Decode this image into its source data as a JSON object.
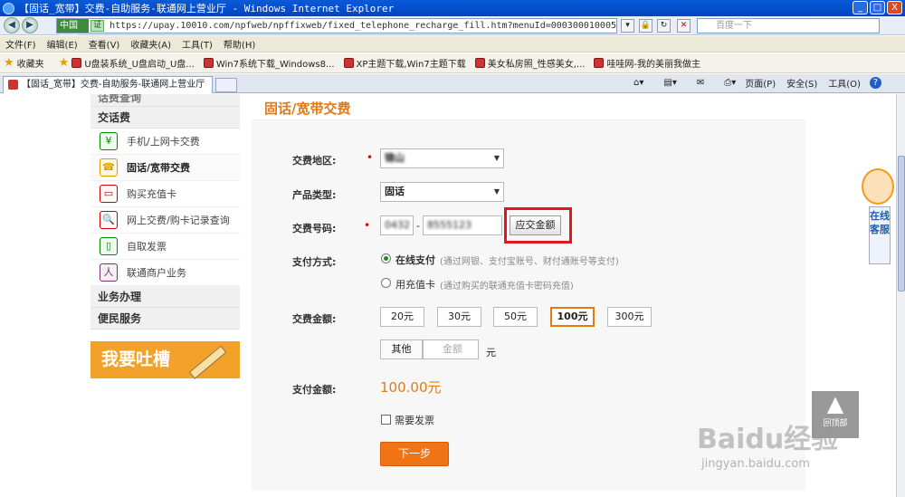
{
  "window": {
    "title": "【固话_宽带】交费-自助服务-联通网上营业厅 - Windows Internet Explorer",
    "min": "_",
    "max": "□",
    "close": "X"
  },
  "address": {
    "tag": "中国联通官网",
    "cert": "证",
    "url": "https://upay.10010.com/npfweb/npffixweb/fixed_telephone_recharge_fill.htm?menuId=000300010005",
    "search_placeholder": "百度一下"
  },
  "menu": [
    "文件(F)",
    "编辑(E)",
    "查看(V)",
    "收藏夹(A)",
    "工具(T)",
    "帮助(H)"
  ],
  "favorites": {
    "label": "收藏夹",
    "items": [
      "U盘装系统_U盘启动_U盘...",
      "Win7系统下载_Windows8...",
      "XP主题下载,Win7主题下载",
      "美女私房照_性感美女,...",
      "哇哇网-我的美丽我做主"
    ]
  },
  "tab": {
    "label": "【固话_宽带】交费-自助服务-联通网上营业厅"
  },
  "toolbar_right": {
    "page": "页面(P)",
    "safety": "安全(S)",
    "tools": "工具(O)",
    "help": "?"
  },
  "sidebar": {
    "cat_top": "话费查询",
    "cat_pay": "交话费",
    "items": [
      {
        "label": "手机/上网卡交费",
        "icon": "¥"
      },
      {
        "label": "固话/宽带交费",
        "icon": "☎"
      },
      {
        "label": "购买充值卡",
        "icon": "▭"
      },
      {
        "label": "网上交费/购卡记录查询",
        "icon": "🔍"
      },
      {
        "label": "自取发票",
        "icon": "▯"
      },
      {
        "label": "联通商户业务",
        "icon": "人"
      }
    ],
    "cat_business": "业务办理",
    "cat_service": "便民服务",
    "banner": "我要吐槽"
  },
  "form": {
    "heading": "固话/宽带交费",
    "area_label": "交费地区:",
    "area_value": "锦山",
    "product_label": "产品类型:",
    "product_value": "固话",
    "number_label": "交费号码:",
    "area_code": "0432",
    "dash": "-",
    "number": "8555123",
    "query_button": "应交金额",
    "pay_method_label": "支付方式:",
    "online_label": "在线支付",
    "online_hint": "(通过网银、支付宝账号、财付通账号等支付)",
    "card_label": "用充值卡",
    "card_hint": "(通过购买的联通充值卡密码充值)",
    "amount_label": "交费金额:",
    "amounts": [
      "20元",
      "30元",
      "50元",
      "100元",
      "300元"
    ],
    "selected_amount": "100元",
    "other_label": "其他",
    "amount_placeholder": "金额",
    "unit": "元",
    "total_label": "支付金额:",
    "total_value": "100.00元",
    "invoice_label": "需要发票",
    "next_button": "下一步"
  },
  "customer_service": {
    "label": "在线客服"
  },
  "to_top": {
    "label": "回顶部"
  },
  "watermark": {
    "main": "Baidu经验",
    "sub": "jingyan.baidu.com"
  }
}
